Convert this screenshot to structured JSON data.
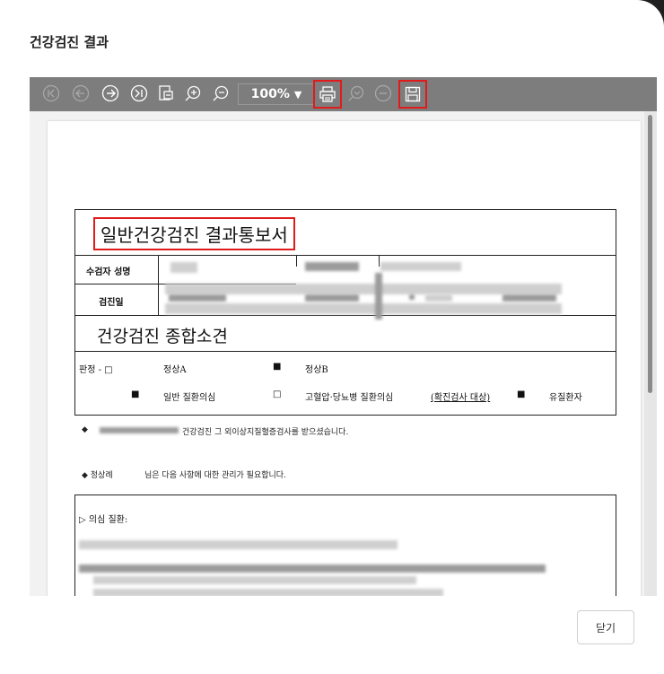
{
  "dialog": {
    "title": "건강검진 결과",
    "close_label": "닫기"
  },
  "toolbar": {
    "zoom_value": "100%",
    "icons": [
      "first-page-icon",
      "prev-page-icon",
      "next-page-icon",
      "last-page-icon",
      "export-icon",
      "zoom-in-icon",
      "zoom-out-icon",
      "print-icon",
      "search-icon",
      "minus-icon",
      "save-icon"
    ]
  },
  "document": {
    "title": "일반건강검진 결과통보서",
    "label_name": "수검자 성명",
    "label_date": "검진일",
    "section_title": "건강검진 종합소견",
    "judgement_label": "판정 - □",
    "opt_normal_a": "정상A",
    "bullet_filled": "■",
    "opt_normal_b": "정상B",
    "opt_general": "일반 질환의심",
    "bullet_empty": "□",
    "opt_hypertension": "고혈압·당뇨병 질환의심",
    "opt_hypertension_note": "(확진검사 대상)",
    "opt_patient": "유질환자",
    "para1_marker": "◆",
    "para1_text": "건강검진 그 외이상지질혈증검사를 받으셨습니다.",
    "para2_marker": "◆ 정상례",
    "para2_text": "님은 다음 사항에 대한 관리가 필요합니다.",
    "disease_header": "▷ 의심 질환:"
  },
  "colors": {
    "highlight": "#e01b1b",
    "toolbar_bg": "#7d7d7d"
  }
}
